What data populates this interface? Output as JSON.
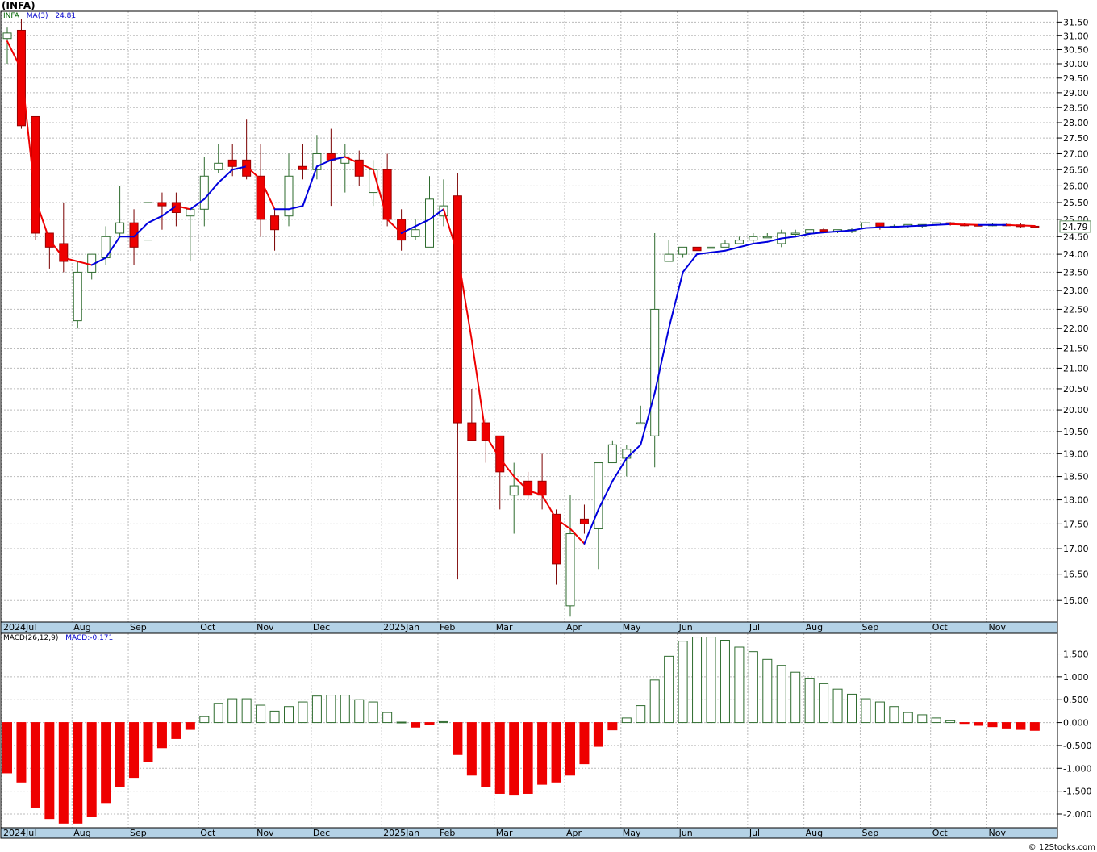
{
  "title": "(INFA)",
  "watermark": "© 12Stocks.com",
  "price_panel": {
    "symbol": "INFA",
    "ma_label": "MA(3)",
    "ma_value": "24.81",
    "last_price": "24.79"
  },
  "macd_panel": {
    "label": "MACD(26,12,9)",
    "value_label": "MACD:-0.171"
  },
  "colors": {
    "up_candle": "#2e6b2e",
    "down_candle": "#ee0000",
    "ma_up": "#0000dd",
    "ma_down": "#ee0000",
    "macd_pos": "#2e6b2e",
    "macd_neg": "#ee0000",
    "grid": "#bbbbbb",
    "axis_strip": "#b4d2e6"
  },
  "chart_data": [
    {
      "type": "candlestick",
      "interval": "weekly",
      "y_scale": "log",
      "ylim": [
        15.6,
        31.9
      ],
      "y_ticks": [
        16.0,
        16.5,
        17.0,
        17.5,
        18.0,
        18.5,
        19.0,
        19.5,
        20.0,
        20.5,
        21.0,
        21.5,
        22.0,
        22.5,
        23.0,
        23.5,
        24.0,
        24.5,
        25.0,
        25.5,
        26.0,
        26.5,
        27.0,
        27.5,
        28.0,
        28.5,
        29.0,
        29.5,
        30.0,
        30.5,
        31.0,
        31.5
      ],
      "x_labels": [
        "2024Jul",
        "Aug",
        "Sep",
        "Oct",
        "Nov",
        "Dec",
        "2025Jan",
        "Feb",
        "Mar",
        "Apr",
        "May",
        "Jun",
        "Jul",
        "Aug",
        "Sep",
        "Oct",
        "Nov"
      ],
      "x_label_week_index": [
        0,
        5,
        9,
        14,
        18,
        22,
        27,
        31,
        35,
        40,
        44,
        48,
        53,
        57,
        61,
        66,
        70
      ],
      "candles": [
        {
          "o": 30.9,
          "h": 31.3,
          "l": 30.0,
          "c": 31.1
        },
        {
          "o": 31.2,
          "h": 31.6,
          "l": 27.8,
          "c": 27.9
        },
        {
          "o": 28.2,
          "h": 28.2,
          "l": 24.4,
          "c": 24.6
        },
        {
          "o": 24.6,
          "h": 24.6,
          "l": 23.6,
          "c": 24.2
        },
        {
          "o": 24.3,
          "h": 25.5,
          "l": 23.5,
          "c": 23.8
        },
        {
          "o": 22.2,
          "h": 23.8,
          "l": 22.0,
          "c": 23.5
        },
        {
          "o": 23.5,
          "h": 24.0,
          "l": 23.3,
          "c": 24.0
        },
        {
          "o": 23.9,
          "h": 24.8,
          "l": 23.7,
          "c": 24.5
        },
        {
          "o": 24.6,
          "h": 26.0,
          "l": 24.5,
          "c": 24.9
        },
        {
          "o": 24.9,
          "h": 25.3,
          "l": 23.7,
          "c": 24.2
        },
        {
          "o": 24.4,
          "h": 26.0,
          "l": 24.2,
          "c": 25.5
        },
        {
          "o": 25.5,
          "h": 25.8,
          "l": 24.7,
          "c": 25.4
        },
        {
          "o": 25.5,
          "h": 25.8,
          "l": 24.8,
          "c": 25.2
        },
        {
          "o": 25.1,
          "h": 25.3,
          "l": 23.8,
          "c": 25.3
        },
        {
          "o": 25.3,
          "h": 26.9,
          "l": 24.8,
          "c": 26.3
        },
        {
          "o": 26.5,
          "h": 27.3,
          "l": 26.4,
          "c": 26.7
        },
        {
          "o": 26.8,
          "h": 27.3,
          "l": 26.3,
          "c": 26.6
        },
        {
          "o": 26.8,
          "h": 28.1,
          "l": 26.2,
          "c": 26.3
        },
        {
          "o": 26.3,
          "h": 27.3,
          "l": 24.5,
          "c": 25.0
        },
        {
          "o": 25.1,
          "h": 25.3,
          "l": 24.1,
          "c": 24.7
        },
        {
          "o": 25.1,
          "h": 27.0,
          "l": 24.8,
          "c": 26.3
        },
        {
          "o": 26.6,
          "h": 27.3,
          "l": 26.2,
          "c": 26.5
        },
        {
          "o": 26.5,
          "h": 27.6,
          "l": 26.2,
          "c": 27.0
        },
        {
          "o": 27.0,
          "h": 27.8,
          "l": 25.4,
          "c": 26.8
        },
        {
          "o": 26.7,
          "h": 27.3,
          "l": 25.8,
          "c": 26.9
        },
        {
          "o": 26.8,
          "h": 27.1,
          "l": 26.0,
          "c": 26.3
        },
        {
          "o": 25.8,
          "h": 26.8,
          "l": 25.4,
          "c": 26.5
        },
        {
          "o": 26.5,
          "h": 27.0,
          "l": 24.8,
          "c": 25.0
        },
        {
          "o": 25.0,
          "h": 25.3,
          "l": 24.1,
          "c": 24.4
        },
        {
          "o": 24.5,
          "h": 25.0,
          "l": 24.4,
          "c": 24.7
        },
        {
          "o": 24.2,
          "h": 26.3,
          "l": 24.2,
          "c": 25.6
        },
        {
          "o": 25.1,
          "h": 26.2,
          "l": 24.8,
          "c": 25.4
        },
        {
          "o": 25.7,
          "h": 26.4,
          "l": 16.4,
          "c": 19.7
        },
        {
          "o": 19.7,
          "h": 20.5,
          "l": 19.3,
          "c": 19.3
        },
        {
          "o": 19.7,
          "h": 19.8,
          "l": 18.8,
          "c": 19.3
        },
        {
          "o": 19.4,
          "h": 19.4,
          "l": 17.8,
          "c": 18.6
        },
        {
          "o": 18.1,
          "h": 18.8,
          "l": 17.3,
          "c": 18.3
        },
        {
          "o": 18.4,
          "h": 18.6,
          "l": 18.0,
          "c": 18.1
        },
        {
          "o": 18.4,
          "h": 19.0,
          "l": 17.8,
          "c": 18.1
        },
        {
          "o": 17.7,
          "h": 17.8,
          "l": 16.3,
          "c": 16.7
        },
        {
          "o": 15.9,
          "h": 18.1,
          "l": 15.7,
          "c": 17.3
        },
        {
          "o": 17.6,
          "h": 17.9,
          "l": 17.3,
          "c": 17.5
        },
        {
          "o": 17.4,
          "h": 18.8,
          "l": 16.6,
          "c": 18.8
        },
        {
          "o": 18.8,
          "h": 19.3,
          "l": 18.8,
          "c": 19.2
        },
        {
          "o": 18.9,
          "h": 19.2,
          "l": 18.5,
          "c": 19.1
        },
        {
          "o": 19.7,
          "h": 20.1,
          "l": 19.7,
          "c": 19.7
        },
        {
          "o": 19.4,
          "h": 24.6,
          "l": 18.7,
          "c": 22.5
        },
        {
          "o": 23.8,
          "h": 24.4,
          "l": 23.8,
          "c": 24.0
        },
        {
          "o": 24.0,
          "h": 24.2,
          "l": 23.9,
          "c": 24.2
        },
        {
          "o": 24.2,
          "h": 24.2,
          "l": 24.1,
          "c": 24.1
        },
        {
          "o": 24.2,
          "h": 24.2,
          "l": 24.2,
          "c": 24.2
        },
        {
          "o": 24.2,
          "h": 24.4,
          "l": 24.2,
          "c": 24.3
        },
        {
          "o": 24.3,
          "h": 24.5,
          "l": 24.3,
          "c": 24.4
        },
        {
          "o": 24.4,
          "h": 24.6,
          "l": 24.3,
          "c": 24.5
        },
        {
          "o": 24.5,
          "h": 24.6,
          "l": 24.5,
          "c": 24.5
        },
        {
          "o": 24.3,
          "h": 24.7,
          "l": 24.2,
          "c": 24.6
        },
        {
          "o": 24.6,
          "h": 24.7,
          "l": 24.5,
          "c": 24.6
        },
        {
          "o": 24.6,
          "h": 24.7,
          "l": 24.6,
          "c": 24.7
        },
        {
          "o": 24.7,
          "h": 24.75,
          "l": 24.6,
          "c": 24.65
        },
        {
          "o": 24.65,
          "h": 24.7,
          "l": 24.6,
          "c": 24.7
        },
        {
          "o": 24.7,
          "h": 24.75,
          "l": 24.6,
          "c": 24.7
        },
        {
          "o": 24.75,
          "h": 24.95,
          "l": 24.7,
          "c": 24.9
        },
        {
          "o": 24.9,
          "h": 24.9,
          "l": 24.7,
          "c": 24.8
        },
        {
          "o": 24.8,
          "h": 24.85,
          "l": 24.75,
          "c": 24.8
        },
        {
          "o": 24.8,
          "h": 24.85,
          "l": 24.75,
          "c": 24.85
        },
        {
          "o": 24.8,
          "h": 24.85,
          "l": 24.75,
          "c": 24.85
        },
        {
          "o": 24.85,
          "h": 24.9,
          "l": 24.8,
          "c": 24.9
        },
        {
          "o": 24.9,
          "h": 24.92,
          "l": 24.82,
          "c": 24.85
        },
        {
          "o": 24.85,
          "h": 24.88,
          "l": 24.8,
          "c": 24.84
        },
        {
          "o": 24.84,
          "h": 24.86,
          "l": 24.8,
          "c": 24.83
        },
        {
          "o": 24.85,
          "h": 24.88,
          "l": 24.8,
          "c": 24.85
        },
        {
          "o": 24.85,
          "h": 24.88,
          "l": 24.8,
          "c": 24.84
        },
        {
          "o": 24.84,
          "h": 24.88,
          "l": 24.74,
          "c": 24.79
        },
        {
          "o": 24.8,
          "h": 24.82,
          "l": 24.74,
          "c": 24.79
        }
      ],
      "ma3": [
        30.8,
        29.8,
        25.6,
        24.4,
        23.9,
        23.8,
        23.7,
        23.9,
        24.5,
        24.5,
        24.9,
        25.1,
        25.4,
        25.3,
        25.6,
        26.1,
        26.5,
        26.6,
        26.2,
        25.3,
        25.3,
        25.4,
        26.6,
        26.8,
        26.9,
        26.7,
        26.5,
        25.0,
        24.6,
        24.8,
        25.0,
        25.3,
        24.0,
        21.7,
        19.4,
        18.9,
        18.5,
        18.2,
        18.1,
        17.6,
        17.4,
        17.1,
        17.8,
        18.4,
        18.9,
        19.2,
        20.4,
        22.0,
        23.5,
        24.0,
        24.05,
        24.1,
        24.2,
        24.3,
        24.35,
        24.45,
        24.5,
        24.58,
        24.62,
        24.65,
        24.68,
        24.75,
        24.77,
        24.78,
        24.8,
        24.82,
        24.84,
        24.86,
        24.85,
        24.84,
        24.84,
        24.84,
        24.82,
        24.81
      ]
    },
    {
      "type": "bar",
      "name": "MACD(26,12,9)",
      "ylim": [
        -2.3,
        1.95
      ],
      "y_ticks": [
        -2.0,
        -1.5,
        -1.0,
        -0.5,
        0.0,
        0.5,
        1.0,
        1.5
      ],
      "y_tick_labels": [
        "-2.000",
        "-1.500",
        "-1.000",
        "-0.500",
        "0.000",
        "0.500",
        "1.000",
        "1.500"
      ],
      "values": [
        -1.1,
        -1.3,
        -1.85,
        -2.1,
        -2.2,
        -2.2,
        -2.05,
        -1.75,
        -1.4,
        -1.2,
        -0.85,
        -0.55,
        -0.35,
        -0.15,
        0.13,
        0.42,
        0.52,
        0.52,
        0.38,
        0.25,
        0.35,
        0.45,
        0.58,
        0.6,
        0.6,
        0.5,
        0.45,
        0.22,
        0.01,
        -0.1,
        -0.04,
        0.02,
        -0.7,
        -1.15,
        -1.4,
        -1.55,
        -1.57,
        -1.55,
        -1.35,
        -1.3,
        -1.15,
        -0.9,
        -0.52,
        -0.16,
        0.1,
        0.37,
        0.93,
        1.45,
        1.78,
        1.87,
        1.87,
        1.8,
        1.65,
        1.55,
        1.38,
        1.25,
        1.1,
        0.97,
        0.85,
        0.73,
        0.62,
        0.52,
        0.45,
        0.35,
        0.22,
        0.17,
        0.1,
        0.04,
        -0.02,
        -0.06,
        -0.09,
        -0.12,
        -0.15,
        -0.171
      ]
    }
  ]
}
